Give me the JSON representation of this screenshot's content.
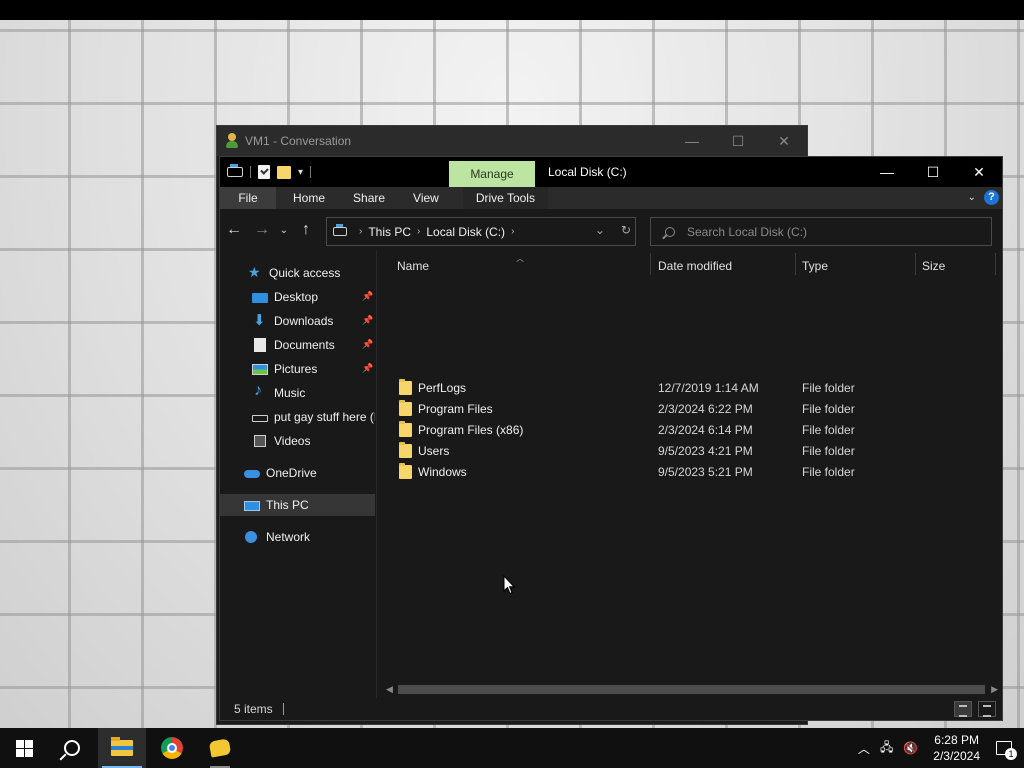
{
  "vm_window": {
    "title": "VM1 - Conversation",
    "controls": {
      "minimize": "—",
      "maximize": "☐",
      "close": "✕"
    }
  },
  "explorer": {
    "ribbon_context_tab": "Manage",
    "window_title": "Local Disk (C:)",
    "controls": {
      "minimize": "—",
      "maximize": "☐",
      "close": "✕"
    },
    "ribbon_tabs": [
      "File",
      "Home",
      "Share",
      "View"
    ],
    "ribbon_context_sub": "Drive Tools",
    "help_label": "?",
    "address": {
      "crumbs": [
        "This PC",
        "Local Disk (C:)"
      ]
    },
    "search": {
      "placeholder": "Search Local Disk (C:)"
    },
    "nav_pane": [
      {
        "label": "Quick access",
        "icon": "star-icon",
        "pinned": false
      },
      {
        "label": "Desktop",
        "icon": "desktop-icon",
        "pinned": true
      },
      {
        "label": "Downloads",
        "icon": "download-icon",
        "pinned": true
      },
      {
        "label": "Documents",
        "icon": "documents-icon",
        "pinned": true
      },
      {
        "label": "Pictures",
        "icon": "pictures-icon",
        "pinned": true
      },
      {
        "label": "Music",
        "icon": "music-icon",
        "pinned": false
      },
      {
        "label": "put gay stuff here (E",
        "icon": "drive-icon",
        "pinned": false
      },
      {
        "label": "Videos",
        "icon": "videos-icon",
        "pinned": false
      },
      {
        "label": "OneDrive",
        "icon": "onedrive-icon",
        "pinned": false
      },
      {
        "label": "This PC",
        "icon": "this-pc-icon",
        "pinned": false,
        "selected": true
      },
      {
        "label": "Network",
        "icon": "network-icon",
        "pinned": false
      }
    ],
    "columns": [
      "Name",
      "Date modified",
      "Type",
      "Size"
    ],
    "files": [
      {
        "name": "PerfLogs",
        "date": "12/7/2019 1:14 AM",
        "type": "File folder"
      },
      {
        "name": "Program Files",
        "date": "2/3/2024 6:22 PM",
        "type": "File folder"
      },
      {
        "name": "Program Files (x86)",
        "date": "2/3/2024 6:14 PM",
        "type": "File folder"
      },
      {
        "name": "Users",
        "date": "9/5/2023 4:21 PM",
        "type": "File folder"
      },
      {
        "name": "Windows",
        "date": "9/5/2023 5:21 PM",
        "type": "File folder"
      }
    ],
    "status": {
      "item_count": "5 items"
    }
  },
  "taskbar": {
    "clock": {
      "time": "6:28 PM",
      "date": "2/3/2024"
    },
    "notification_count": "1",
    "pinned_apps": [
      "start-icon",
      "search-icon",
      "file-explorer-icon",
      "chrome-icon",
      "chat-icon"
    ]
  },
  "colors": {
    "manage_tab": "#bde5a2",
    "window_bg": "#191919",
    "taskbar_bg": "#101010",
    "folder": "#f6d66b"
  }
}
